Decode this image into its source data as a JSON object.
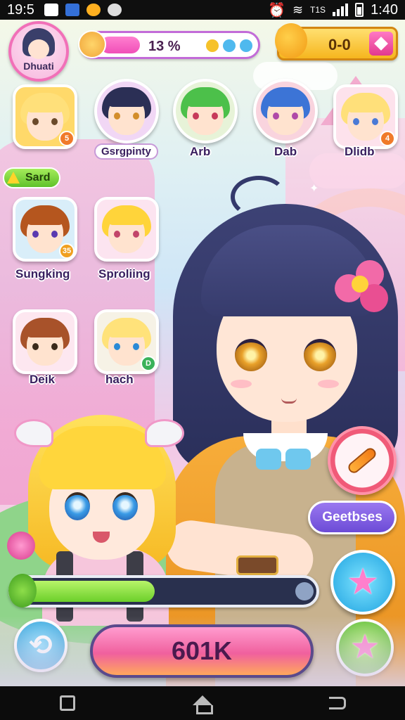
{
  "status_bar": {
    "time": "19:5",
    "carrier": "T1S",
    "clock": "1:40"
  },
  "profile": {
    "name": "Dhuati"
  },
  "progress": {
    "percent_label": "13 %",
    "fraction": 0.13
  },
  "currency": {
    "value": "0-0"
  },
  "section": {
    "label": "Sard"
  },
  "characters": [
    {
      "name": "",
      "badge": "5"
    },
    {
      "name": "Gsrgpinty",
      "badge": ""
    },
    {
      "name": "Arb",
      "badge": ""
    },
    {
      "name": "Dab",
      "badge": ""
    },
    {
      "name": "Dlidb",
      "badge": "4"
    },
    {
      "name": "Sungking",
      "badge": "35"
    },
    {
      "name": "Sproliing",
      "badge": ""
    },
    {
      "name": "Deik",
      "badge": ""
    },
    {
      "name": "hach",
      "badge": "D"
    }
  ],
  "buttons": {
    "geet": "Geetbses",
    "main": "601K"
  },
  "energy": {
    "fraction": 0.47
  },
  "colors": {
    "accent_pink": "#f04fb8",
    "accent_purple": "#6c4bd6",
    "energy_green": "#6bcf2a",
    "coin_gold": "#f6b61e"
  },
  "icons": {
    "profile": "avatar-icon",
    "pencil": "pencil-icon",
    "star": "star-icon",
    "swap": "swap-icon",
    "favorite": "star-icon",
    "currency": "fox-coin-icon",
    "add": "diamond-plus-icon"
  }
}
